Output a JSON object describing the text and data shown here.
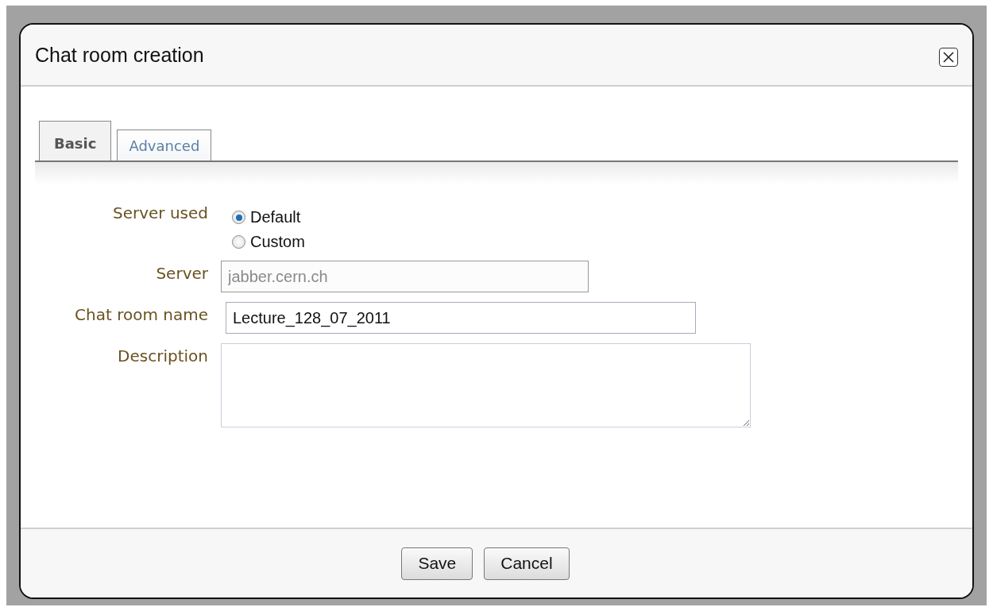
{
  "dialog": {
    "title": "Chat room creation"
  },
  "tabs": [
    {
      "label": "Basic",
      "selected": true
    },
    {
      "label": "Advanced",
      "selected": false
    }
  ],
  "server_used": {
    "label": "Server used",
    "options": [
      {
        "label": "Default",
        "selected": true
      },
      {
        "label": "Custom",
        "selected": false
      }
    ]
  },
  "fields": [
    {
      "kind": "input",
      "label": "Server",
      "value": "jabber.cern.ch",
      "disabled": true
    },
    {
      "kind": "input",
      "label": "Chat room name",
      "value": "Lecture_128_07_2011",
      "disabled": false
    },
    {
      "kind": "textarea",
      "label": "Description"
    }
  ],
  "buttons": [
    "Save",
    "Cancel"
  ]
}
